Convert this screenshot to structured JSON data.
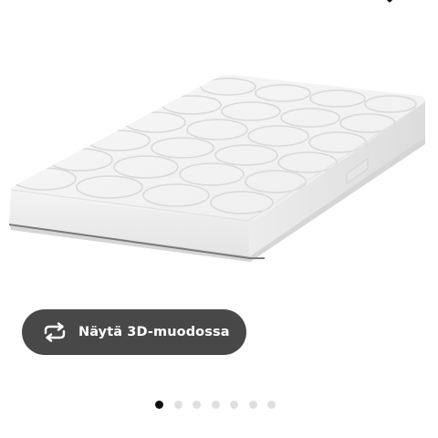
{
  "top_icon": "chevron-down-icon",
  "product_image": {
    "subject": "mattress-image"
  },
  "view3d": {
    "label": "Näytä 3D-muodossa",
    "icon": "rotate-3d-icon",
    "background": "#484848",
    "text_color": "#ffffff"
  },
  "carousel": {
    "total_images": 7,
    "active_index": 0,
    "active_color": "#111111",
    "inactive_color": "#dfdfdf"
  }
}
